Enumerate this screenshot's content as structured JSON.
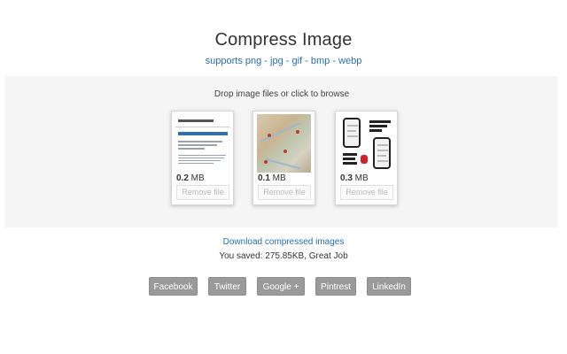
{
  "header": {
    "title": "Compress Image",
    "subtitle": "supports png - jpg - gif - bmp - webp"
  },
  "dropzone": {
    "hint": "Drop image files or click to browse",
    "files": [
      {
        "size_value": "0.2",
        "size_unit": " MB",
        "remove_label": "Remove file",
        "thumbnail": "document-screenshot"
      },
      {
        "size_value": "0.1",
        "size_unit": " MB",
        "remove_label": "Remove file",
        "thumbnail": "map-screenshot"
      },
      {
        "size_value": "0.3",
        "size_unit": " MB",
        "remove_label": "Remove file",
        "thumbnail": "app-promo-screenshot"
      }
    ]
  },
  "result": {
    "download_label": "Download compressed images",
    "saved_text": "You saved: 275.85KB, Great Job"
  },
  "share": {
    "facebook": "Facebook",
    "twitter": "Twitter",
    "google": "Google +",
    "pintrest": "Pintrest",
    "linkedin": "LinkedIn"
  },
  "colors": {
    "link": "#2a6db0",
    "dropzone_bg": "#f5f5f5",
    "share_button_bg": "#9a9a9a"
  }
}
